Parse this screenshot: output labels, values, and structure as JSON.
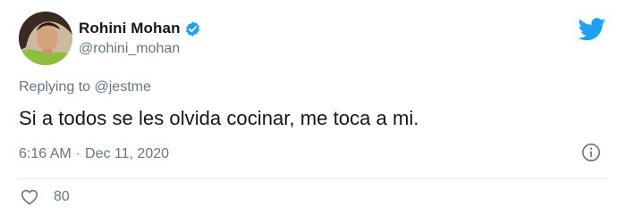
{
  "author": {
    "display_name": "Rohini Mohan",
    "handle": "@rohini_mohan",
    "verified": true
  },
  "reply": {
    "prefix": "Replying to ",
    "mention": "@jestme"
  },
  "tweet": {
    "text": "Si a todos se les olvida cocinar, me toca a mi.",
    "time": "6:16 AM",
    "separator": "·",
    "date": "Dec 11, 2020"
  },
  "engagement": {
    "likes": "80"
  },
  "icons": {
    "logo": "twitter-bird-icon",
    "verified": "verified-badge-icon",
    "info": "info-icon",
    "like": "heart-icon"
  },
  "colors": {
    "brand_blue": "#1da1f2",
    "text_primary": "#14171a",
    "text_secondary": "#657786",
    "divider": "#e1e8ed"
  }
}
